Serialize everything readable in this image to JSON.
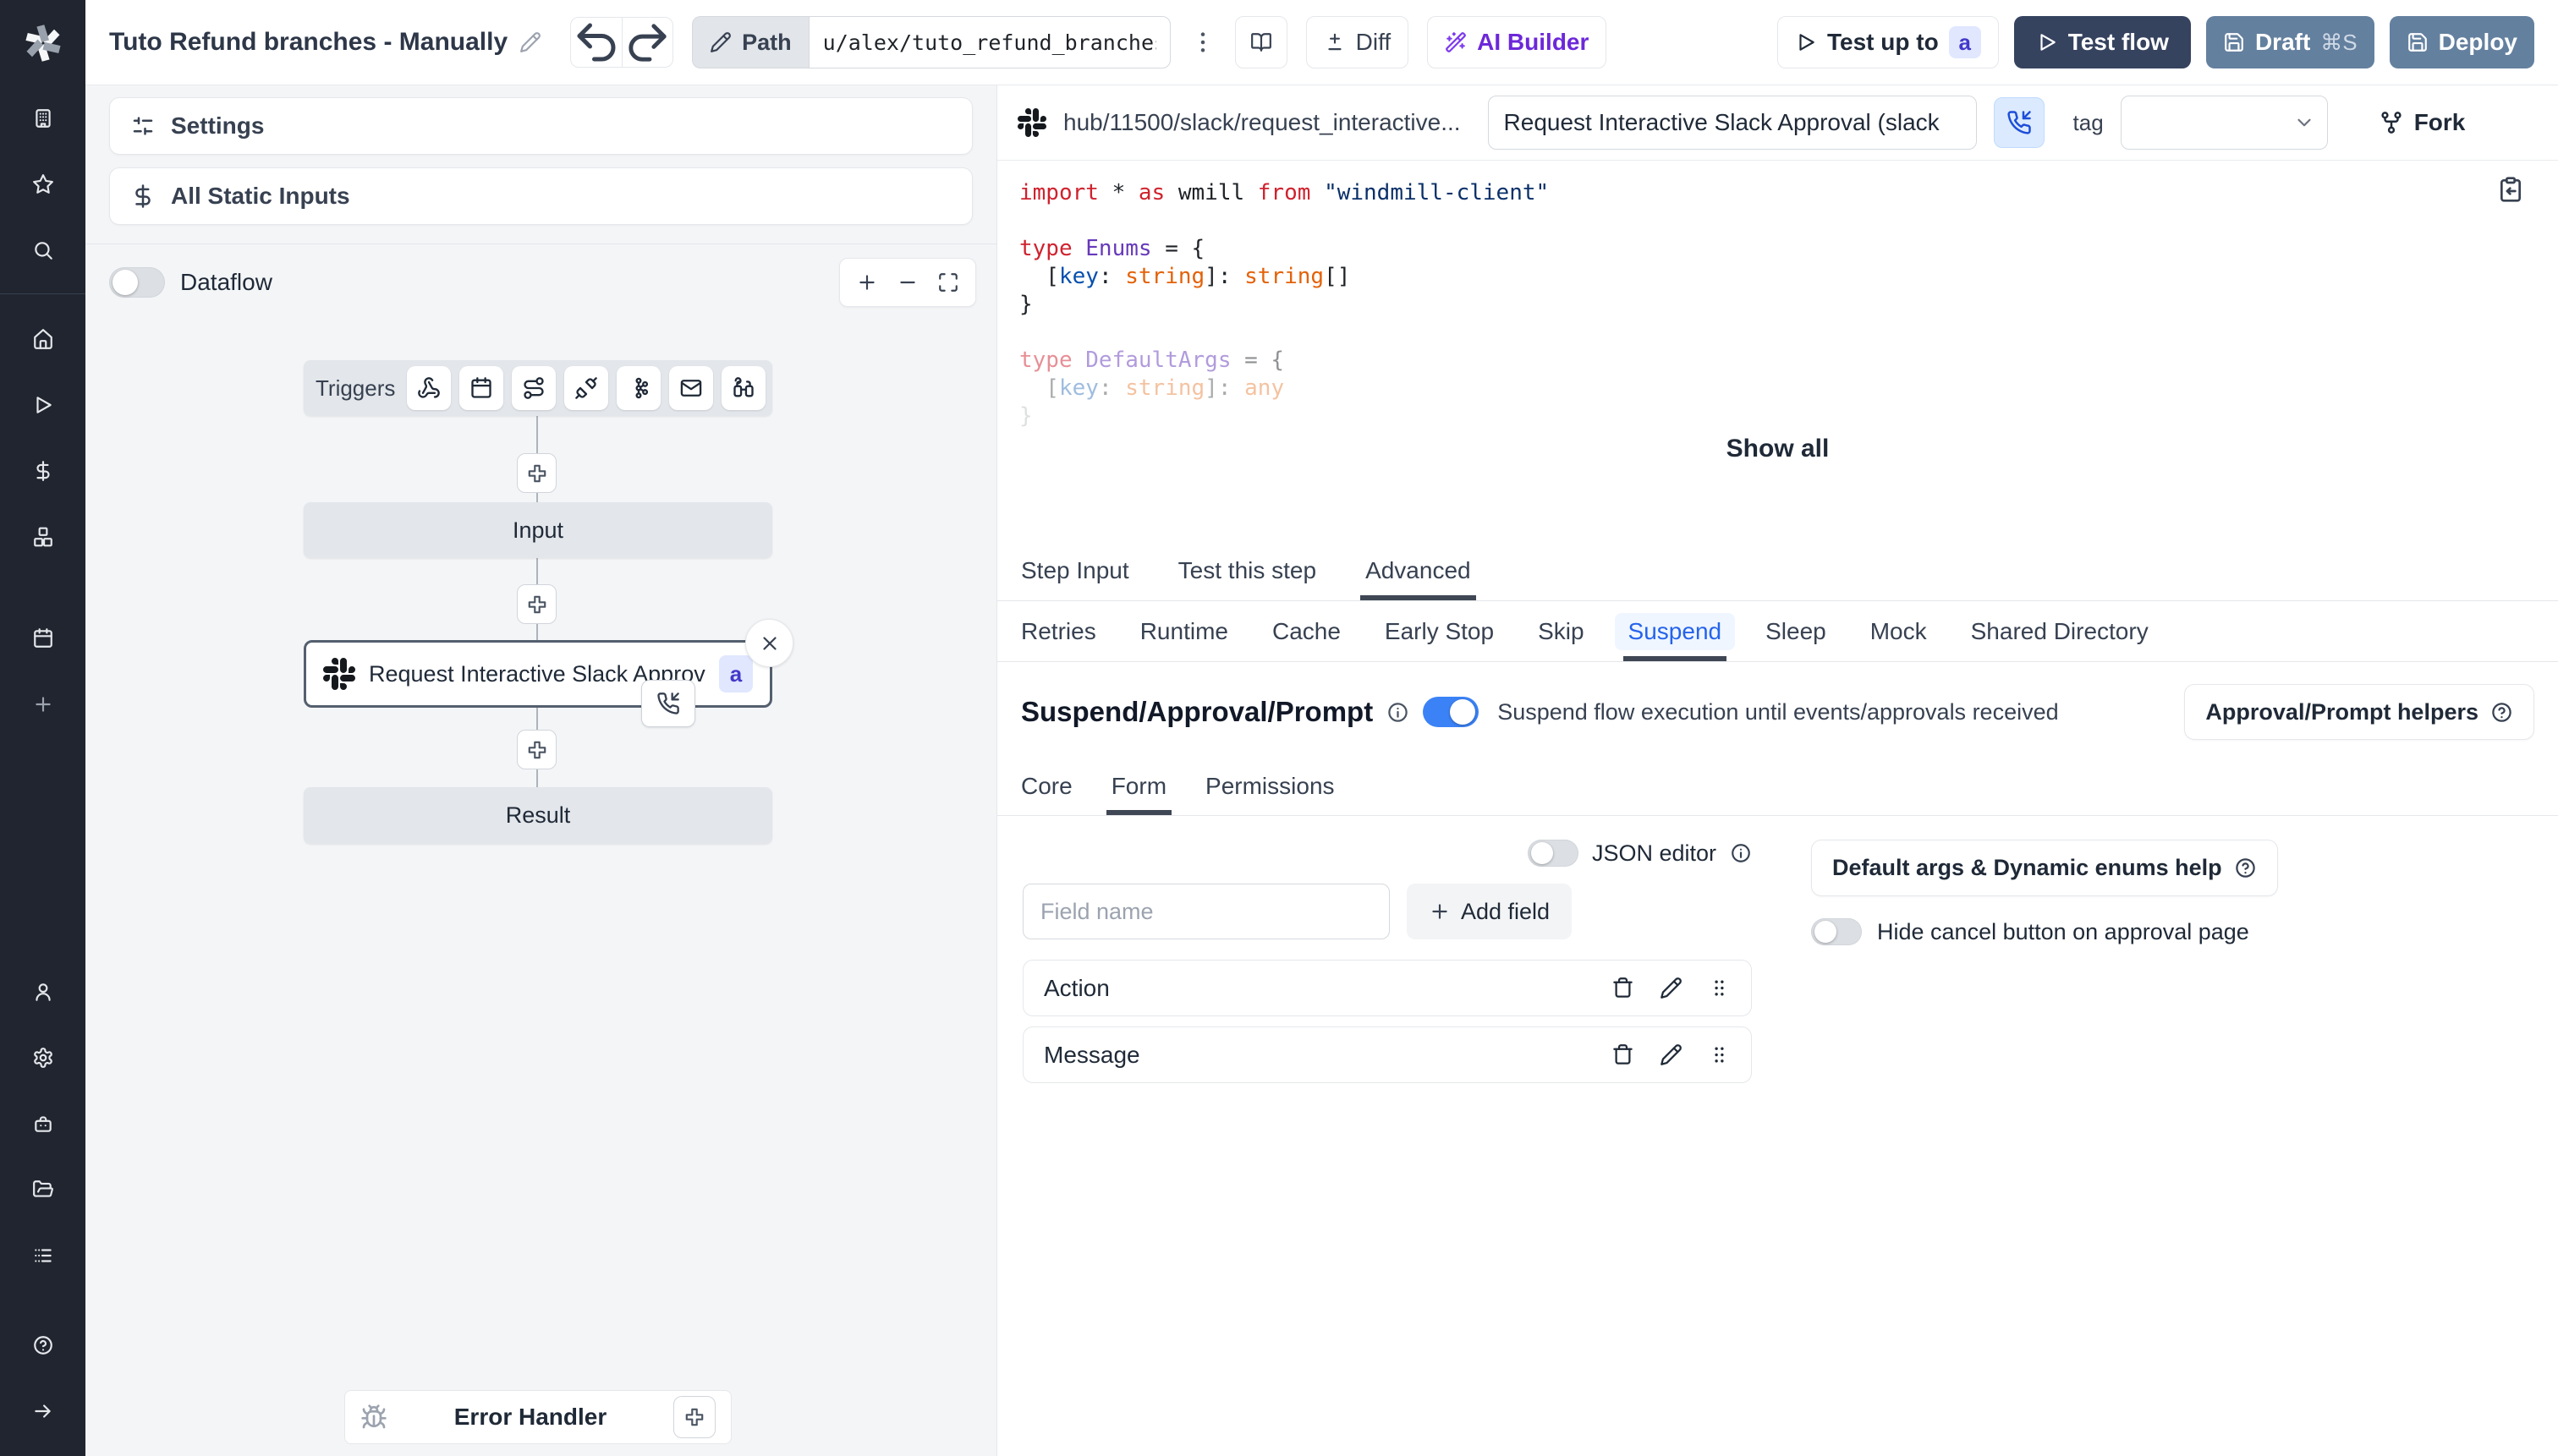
{
  "header": {
    "title": "Tuto Refund branches - Manually",
    "path_label": "Path",
    "path_value": "u/alex/tuto_refund_branches_",
    "diff_label": "Diff",
    "ai_builder_label": "AI Builder",
    "test_up_to_label": "Test up to",
    "test_up_to_badge": "a",
    "test_flow_label": "Test flow",
    "draft_label": "Draft",
    "draft_shortcut": "⌘S",
    "deploy_label": "Deploy"
  },
  "rail": {
    "top": [
      "building",
      "star",
      "search"
    ],
    "mid": [
      "home",
      "play",
      "dollar",
      "boxes"
    ],
    "low": [
      "calendar",
      "plus"
    ],
    "tools": [
      "user",
      "gear",
      "bot",
      "folder",
      "list"
    ],
    "footer": [
      "help",
      "arrow-right"
    ]
  },
  "left_panel": {
    "settings_label": "Settings",
    "static_inputs_label": "All Static Inputs",
    "dataflow_label": "Dataflow",
    "triggers_label": "Triggers",
    "trigger_icons": [
      "webhook",
      "calendar",
      "route",
      "plug",
      "kafka",
      "mail",
      "poll"
    ],
    "node_input_label": "Input",
    "node_step_label": "Request Interactive Slack Approval (...",
    "node_step_badge": "a",
    "node_result_label": "Result",
    "error_handler_label": "Error Handler"
  },
  "step_panel": {
    "hub_path": "hub/11500/slack/request_interactive...",
    "title_value": "Request Interactive Slack Approval (slack",
    "tag_label": "tag",
    "fork_label": "Fork",
    "show_all_label": "Show all",
    "code_lines": [
      {
        "o": 1,
        "t": [
          [
            "import",
            "kw"
          ],
          [
            " * ",
            "pl"
          ],
          [
            "as",
            "kw"
          ],
          [
            " wmill ",
            "pl"
          ],
          [
            "from",
            "kw"
          ],
          [
            " ",
            "pl"
          ],
          [
            "\"windmill-client\"",
            "str"
          ]
        ]
      },
      {
        "o": 1,
        "t": []
      },
      {
        "o": 1,
        "t": [
          [
            "type",
            "kw"
          ],
          [
            " ",
            "pl"
          ],
          [
            "Enums",
            "tp"
          ],
          [
            " = {",
            "pl"
          ]
        ]
      },
      {
        "o": 1,
        "t": [
          [
            "  [",
            "pl"
          ],
          [
            "key",
            "pr"
          ],
          [
            ": ",
            "pl"
          ],
          [
            "string",
            "tn"
          ],
          [
            "]: ",
            "pl"
          ],
          [
            "string",
            "tn"
          ],
          [
            "[]",
            "pl"
          ]
        ]
      },
      {
        "o": 1,
        "t": [
          [
            "}",
            "pl"
          ]
        ]
      },
      {
        "o": 1,
        "t": []
      },
      {
        "o": 0.5,
        "t": [
          [
            "type",
            "kw"
          ],
          [
            " ",
            "pl"
          ],
          [
            "DefaultArgs",
            "tp"
          ],
          [
            " = {",
            "pl"
          ]
        ]
      },
      {
        "o": 0.38,
        "t": [
          [
            "  [",
            "pl"
          ],
          [
            "key",
            "pr"
          ],
          [
            ": ",
            "pl"
          ],
          [
            "string",
            "tn"
          ],
          [
            "]: ",
            "pl"
          ],
          [
            "any",
            "tn"
          ]
        ]
      },
      {
        "o": 0.14,
        "t": [
          [
            "}",
            "pl"
          ]
        ]
      }
    ],
    "tabs": {
      "items": [
        "Step Input",
        "Test this step",
        "Advanced"
      ],
      "active": 2
    },
    "subtabs": {
      "items": [
        "Retries",
        "Runtime",
        "Cache",
        "Early Stop",
        "Skip",
        "Suspend",
        "Sleep",
        "Mock",
        "Shared Directory"
      ],
      "active": 5
    },
    "suspend": {
      "heading": "Suspend/Approval/Prompt",
      "toggle_on": true,
      "toggle_text": "Suspend flow execution until events/approvals received",
      "helpers_label": "Approval/Prompt helpers",
      "tabs": {
        "items": [
          "Core",
          "Form",
          "Permissions"
        ],
        "active": 1
      },
      "json_editor_label": "JSON editor",
      "field_placeholder": "Field name",
      "add_field_label": "Add field",
      "fields": [
        "Action",
        "Message"
      ],
      "default_args_label": "Default args & Dynamic enums help",
      "hide_cancel_label": "Hide cancel button on approval page"
    }
  },
  "colors": {
    "accent_blue": "#3b82f6",
    "active_subtab_text": "#2563eb",
    "active_subtab_bg": "#eff6ff",
    "navy_button": "#36435f",
    "slate_button": "#64809f",
    "badge_bg": "#e0e7ff",
    "badge_text": "#4338ca",
    "rail_bg": "#20252f",
    "canvas_bg": "#f4f5f7",
    "code_keyword": "#cf222e",
    "code_string": "#0a3069",
    "code_type": "#6639ba",
    "code_prop": "#0550ae",
    "code_typename": "#e36209"
  }
}
